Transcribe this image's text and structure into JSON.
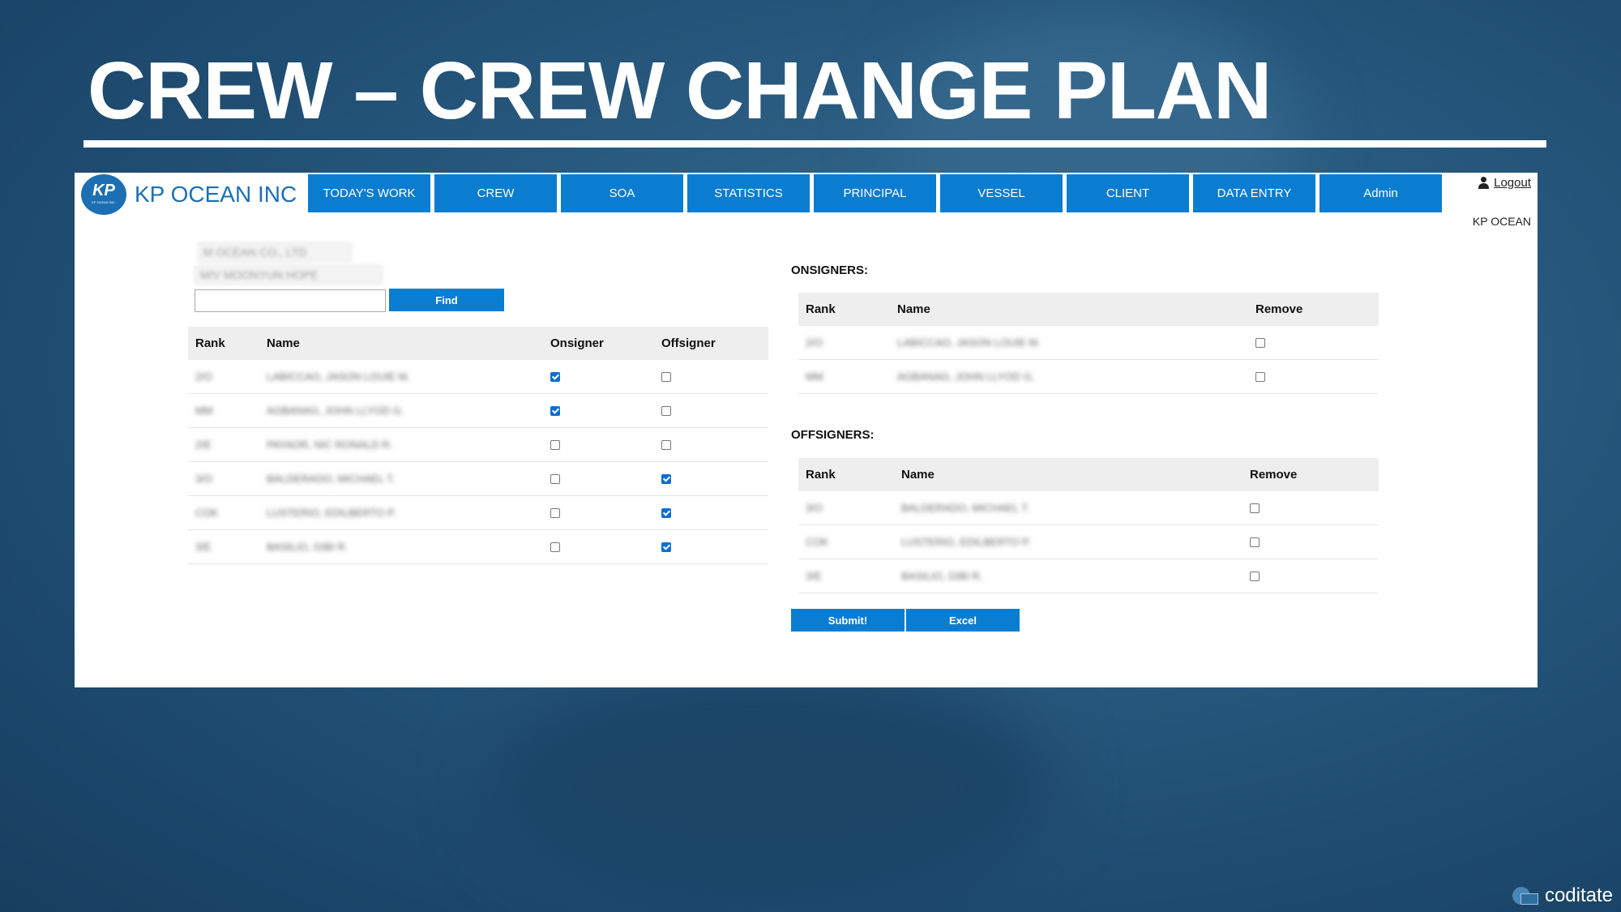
{
  "slide": {
    "title": "CREW – CREW CHANGE PLAN"
  },
  "header": {
    "brand": "KP OCEAN INC",
    "brand_short": "KP",
    "brand_small": "KP OCEAN INC.",
    "nav": [
      {
        "label": "TODAY'S WORK"
      },
      {
        "label": "CREW"
      },
      {
        "label": "SOA"
      },
      {
        "label": "STATISTICS"
      },
      {
        "label": "PRINCIPAL"
      },
      {
        "label": "VESSEL"
      },
      {
        "label": "CLIENT"
      },
      {
        "label": "DATA ENTRY"
      },
      {
        "label": "Admin"
      }
    ],
    "logout_label": "Logout",
    "company": "KP OCEAN"
  },
  "filters": {
    "principal_value": "M OCEAN CO., LTD",
    "vessel_value": "M/V MOONYUN HOPE",
    "search_value": "",
    "find_label": "Find"
  },
  "crew_table": {
    "headers": {
      "rank": "Rank",
      "name": "Name",
      "onsigner": "Onsigner",
      "offsigner": "Offsigner"
    },
    "rows": [
      {
        "rank": "2/O",
        "name": "LABICCAO, JASON LOUIE M.",
        "onsigner": true,
        "offsigner": false
      },
      {
        "rank": "MM",
        "name": "AGBANAG, JOHN LLYOD G.",
        "onsigner": true,
        "offsigner": false
      },
      {
        "rank": "2/E",
        "name": "PAYAOR, NIC RONALD R.",
        "onsigner": false,
        "offsigner": false
      },
      {
        "rank": "3/O",
        "name": "BALDERADO, MICHAEL T.",
        "onsigner": false,
        "offsigner": true
      },
      {
        "rank": "COK",
        "name": "LUSTERIO, EDILBERTO P.",
        "onsigner": false,
        "offsigner": true
      },
      {
        "rank": "3/E",
        "name": "BASILIO, GIBI R.",
        "onsigner": false,
        "offsigner": true
      }
    ]
  },
  "onsigners": {
    "label": "ONSIGNERS:",
    "headers": {
      "rank": "Rank",
      "name": "Name",
      "remove": "Remove"
    },
    "rows": [
      {
        "rank": "2/O",
        "name": "LABICCAO, JASON LOUIE M."
      },
      {
        "rank": "MM",
        "name": "AGBANAG, JOHN LLYOD G."
      }
    ]
  },
  "offsigners": {
    "label": "OFFSIGNERS:",
    "headers": {
      "rank": "Rank",
      "name": "Name",
      "remove": "Remove"
    },
    "rows": [
      {
        "rank": "3/O",
        "name": "BALDERADO, MICHAEL T."
      },
      {
        "rank": "COK",
        "name": "LUSTERIO, EDILBERTO P."
      },
      {
        "rank": "3/E",
        "name": "BASILIO, GIBI R."
      }
    ]
  },
  "actions": {
    "submit_label": "Submit!",
    "excel_label": "Excel"
  },
  "watermark": {
    "text": "coditate"
  },
  "colors": {
    "primary": "#0b7dd0",
    "brand": "#1d6fb3",
    "background": "#1f4d72"
  }
}
